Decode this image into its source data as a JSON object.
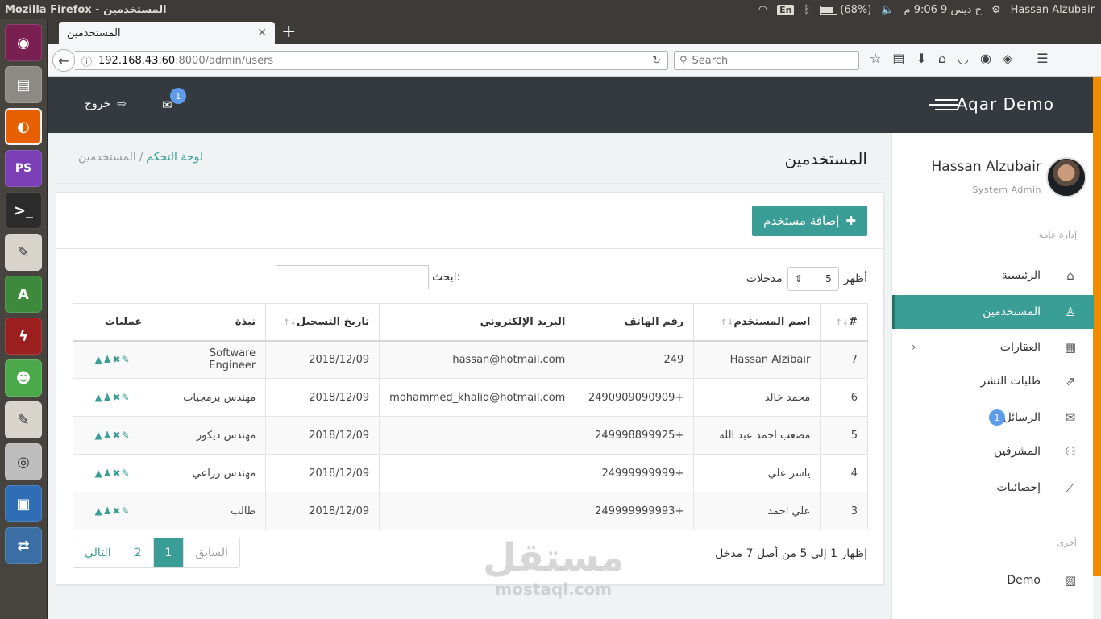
{
  "os": {
    "window_title": "Mozilla Firefox - المستخدمين",
    "tray": {
      "lang": "En",
      "battery": "(68%)",
      "clock": "ح ديس  9  9:06 م",
      "user": "Hassan Alzubair"
    }
  },
  "browser": {
    "tab_title": "المستخدمين",
    "url_host": "192.168.43.60",
    "url_rest": ":8000/admin/users",
    "search_placeholder": "Search"
  },
  "app": {
    "brand": "Aqar Demo",
    "logout_label": "خروج",
    "mail_badge": "1",
    "accent_color": "#3a9d96"
  },
  "sidebar": {
    "profile_name": "Hassan Alzubair",
    "profile_role": "System Admin",
    "section_general": "إدارة عامة",
    "section_other": "أخرى",
    "items": [
      {
        "label": "الرئيسية",
        "icon": "home-icon"
      },
      {
        "label": "المستخدمين",
        "icon": "user-icon"
      },
      {
        "label": "العقارات",
        "icon": "building-icon"
      },
      {
        "label": "طلبات النشر",
        "icon": "share-icon"
      },
      {
        "label": "الرسائل",
        "icon": "envelope-icon",
        "count": "1"
      },
      {
        "label": "المشرفين",
        "icon": "users-icon"
      },
      {
        "label": "إحصائيات",
        "icon": "chart-icon"
      },
      {
        "label": "Demo",
        "icon": "image-icon"
      }
    ]
  },
  "main": {
    "page_title": "المستخدمين",
    "breadcrumb_home": "لوحة التحكم",
    "breadcrumb_sep": "/",
    "breadcrumb_current": "المستخدمين",
    "add_button": "إضافة مستخدم",
    "length_show": "أظهر",
    "length_value": "5",
    "length_entries": "مدخلات",
    "search_label": "ابحث:",
    "table": {
      "headers": [
        "#",
        "اسم المستخدم",
        "رقم الهاتف",
        "البريد الإلكتروني",
        "تاريخ التسجيل",
        "نبذة",
        "عمليات"
      ],
      "rows": [
        [
          "7",
          "Hassan Alzibair",
          "249",
          "hassan@hotmail.com",
          "2018/12/09",
          "Software Engineer"
        ],
        [
          "6",
          "محمد خالد",
          "+2490909090909",
          "mohammed_khalid@hotmail.com",
          "2018/12/09",
          "مهندس برمجيات"
        ],
        [
          "5",
          "مصعب احمد عبد الله",
          "+249998899925",
          "",
          "2018/12/09",
          "مهندس ديكور"
        ],
        [
          "4",
          "ياسر علي",
          "+24999999999",
          "",
          "2018/12/09",
          "مهندس زراعي"
        ],
        [
          "3",
          "علي احمد",
          "+249999999993",
          "",
          "2018/12/09",
          "طالب"
        ]
      ]
    },
    "info": "إظهار 1 إلى 5 من أصل 7 مدخل",
    "pagination": {
      "prev": "السابق",
      "p1": "1",
      "p2": "2",
      "next": "التالي"
    }
  },
  "watermark": {
    "ar": "مستقل",
    "en": "mostaql.com"
  }
}
